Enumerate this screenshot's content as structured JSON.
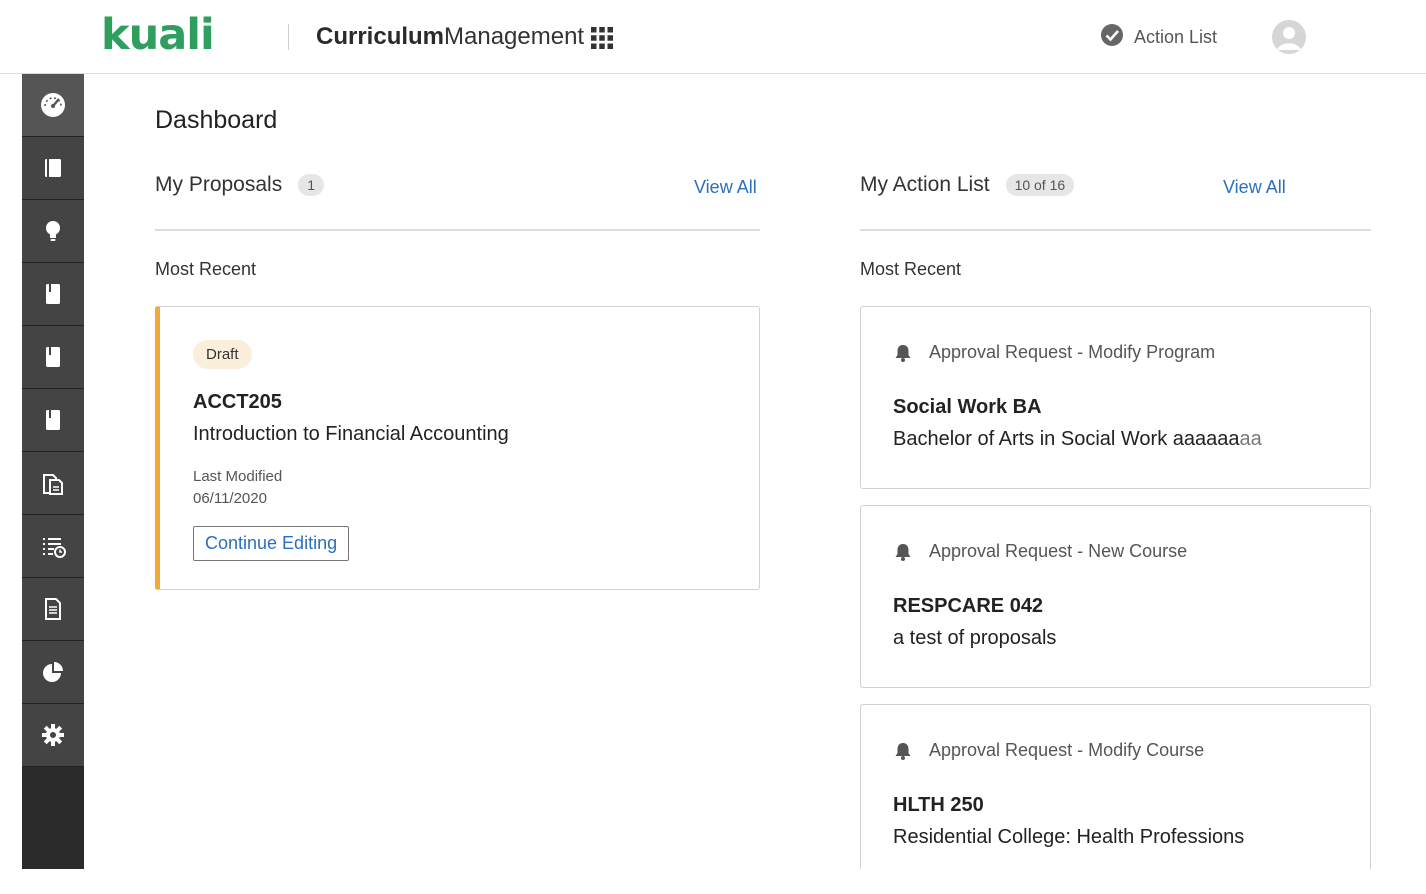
{
  "header": {
    "logo_text": "kuali",
    "app_title_bold": "Curriculum",
    "app_title_light": "Management",
    "action_list_label": "Action List",
    "brand_color": "#2e9f5e"
  },
  "sidebar": {
    "items": [
      {
        "icon": "dashboard-icon",
        "active": true
      },
      {
        "icon": "book-icon"
      },
      {
        "icon": "lightbulb-icon"
      },
      {
        "icon": "notebook-icon"
      },
      {
        "icon": "notebook-icon"
      },
      {
        "icon": "notebook-icon"
      },
      {
        "icon": "documents-icon"
      },
      {
        "icon": "list-clock-icon"
      },
      {
        "icon": "file-icon"
      },
      {
        "icon": "pie-chart-icon"
      },
      {
        "icon": "gear-icon"
      }
    ]
  },
  "page": {
    "title": "Dashboard"
  },
  "proposals": {
    "heading": "My Proposals",
    "count": "1",
    "view_all": "View All",
    "most_recent": "Most Recent",
    "card": {
      "status": "Draft",
      "code": "ACCT205",
      "name": "Introduction to Financial Accounting",
      "last_modified_label": "Last Modified",
      "last_modified_date": "06/11/2020",
      "button": "Continue Editing",
      "accent_color": "#f2a93b"
    }
  },
  "action_list": {
    "heading": "My Action List",
    "count": "10 of 16",
    "view_all": "View All",
    "most_recent": "Most Recent",
    "items": [
      {
        "request": "Approval Request - Modify Program",
        "title": "Social Work BA",
        "subtitle": "Bachelor of Arts in Social Work aaaaaa",
        "subtitle_fade": "aa"
      },
      {
        "request": "Approval Request - New Course",
        "title": "RESPCARE 042",
        "subtitle": "a test of proposals",
        "subtitle_fade": ""
      },
      {
        "request": "Approval Request - Modify Course",
        "title": "HLTH 250",
        "subtitle": "Residential College: Health Professions",
        "subtitle_fade": ""
      }
    ]
  },
  "link_color": "#2a6fbf"
}
